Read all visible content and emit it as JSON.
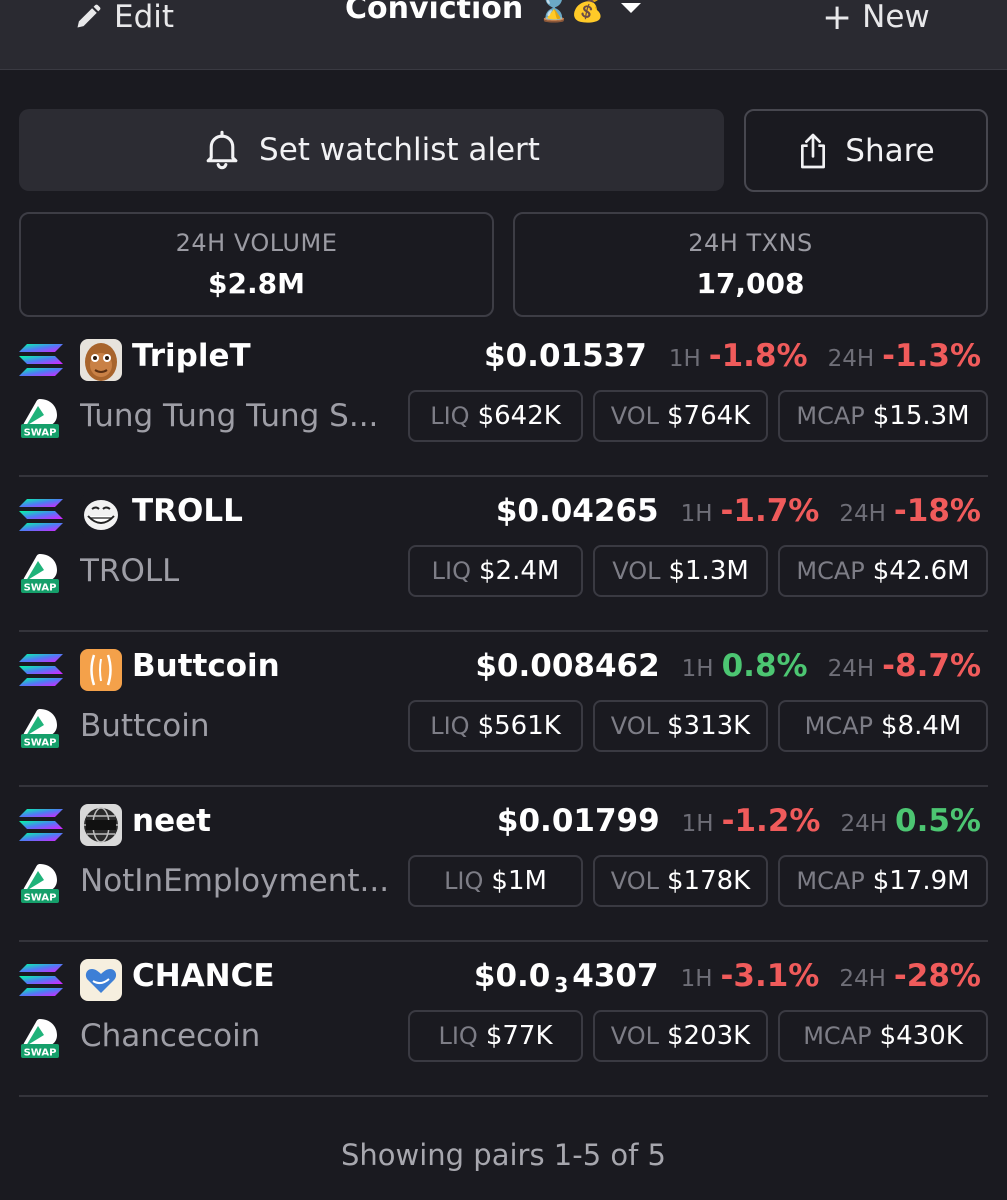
{
  "header": {
    "edit_label": "Edit",
    "title": "Conviction",
    "title_emoji": "⌛💰",
    "new_label": "New"
  },
  "actions": {
    "alert_label": "Set watchlist alert",
    "share_label": "Share"
  },
  "stats": {
    "volume_label": "24H VOLUME",
    "volume_value": "$2.8M",
    "txns_label": "24H TXNS",
    "txns_value": "17,008"
  },
  "labels": {
    "h1": "1H",
    "h24": "24H",
    "liq": "LIQ",
    "vol": "VOL",
    "mcap": "MCAP",
    "swap": "SWAP"
  },
  "pairs": [
    {
      "symbol": "TripleT",
      "name": "Tung Tung Tung S...",
      "price": "$0.01537",
      "change_1h": "-1.8%",
      "change_24h": "-1.3%",
      "liq": "$642K",
      "vol": "$764K",
      "mcap": "$15.3M"
    },
    {
      "symbol": "TROLL",
      "name": "TROLL",
      "price": "$0.04265",
      "change_1h": "-1.7%",
      "change_24h": "-18%",
      "liq": "$2.4M",
      "vol": "$1.3M",
      "mcap": "$42.6M"
    },
    {
      "symbol": "Buttcoin",
      "name": "Buttcoin",
      "price": "$0.008462",
      "change_1h": "0.8%",
      "change_24h": "-8.7%",
      "liq": "$561K",
      "vol": "$313K",
      "mcap": "$8.4M"
    },
    {
      "symbol": "neet",
      "name": "NotInEmployment...",
      "price": "$0.01799",
      "change_1h": "-1.2%",
      "change_24h": "0.5%",
      "liq": "$1M",
      "vol": "$178K",
      "mcap": "$17.9M"
    },
    {
      "symbol": "CHANCE",
      "name": "Chancecoin",
      "price_prefix": "$0.0",
      "price_zeros": "3",
      "price_suffix": "4307",
      "change_1h": "-3.1%",
      "change_24h": "-28%",
      "liq": "$77K",
      "vol": "$203K",
      "mcap": "$430K"
    }
  ],
  "footer": {
    "text": "Showing pairs 1-5 of 5"
  },
  "colors": {
    "background": "#1a1a20",
    "negative": "#f05b5b",
    "positive": "#4cc672"
  }
}
